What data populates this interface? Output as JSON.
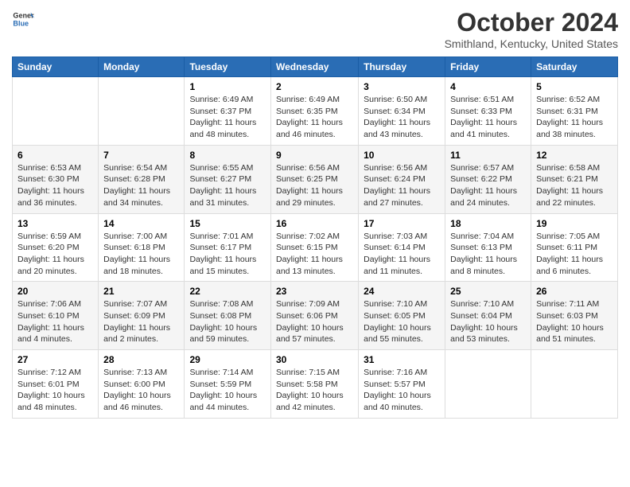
{
  "header": {
    "logo_general": "General",
    "logo_blue": "Blue",
    "title": "October 2024",
    "location": "Smithland, Kentucky, United States"
  },
  "columns": [
    "Sunday",
    "Monday",
    "Tuesday",
    "Wednesday",
    "Thursday",
    "Friday",
    "Saturday"
  ],
  "weeks": [
    [
      {
        "day": "",
        "info": ""
      },
      {
        "day": "",
        "info": ""
      },
      {
        "day": "1",
        "info": "Sunrise: 6:49 AM\nSunset: 6:37 PM\nDaylight: 11 hours and 48 minutes."
      },
      {
        "day": "2",
        "info": "Sunrise: 6:49 AM\nSunset: 6:35 PM\nDaylight: 11 hours and 46 minutes."
      },
      {
        "day": "3",
        "info": "Sunrise: 6:50 AM\nSunset: 6:34 PM\nDaylight: 11 hours and 43 minutes."
      },
      {
        "day": "4",
        "info": "Sunrise: 6:51 AM\nSunset: 6:33 PM\nDaylight: 11 hours and 41 minutes."
      },
      {
        "day": "5",
        "info": "Sunrise: 6:52 AM\nSunset: 6:31 PM\nDaylight: 11 hours and 38 minutes."
      }
    ],
    [
      {
        "day": "6",
        "info": "Sunrise: 6:53 AM\nSunset: 6:30 PM\nDaylight: 11 hours and 36 minutes."
      },
      {
        "day": "7",
        "info": "Sunrise: 6:54 AM\nSunset: 6:28 PM\nDaylight: 11 hours and 34 minutes."
      },
      {
        "day": "8",
        "info": "Sunrise: 6:55 AM\nSunset: 6:27 PM\nDaylight: 11 hours and 31 minutes."
      },
      {
        "day": "9",
        "info": "Sunrise: 6:56 AM\nSunset: 6:25 PM\nDaylight: 11 hours and 29 minutes."
      },
      {
        "day": "10",
        "info": "Sunrise: 6:56 AM\nSunset: 6:24 PM\nDaylight: 11 hours and 27 minutes."
      },
      {
        "day": "11",
        "info": "Sunrise: 6:57 AM\nSunset: 6:22 PM\nDaylight: 11 hours and 24 minutes."
      },
      {
        "day": "12",
        "info": "Sunrise: 6:58 AM\nSunset: 6:21 PM\nDaylight: 11 hours and 22 minutes."
      }
    ],
    [
      {
        "day": "13",
        "info": "Sunrise: 6:59 AM\nSunset: 6:20 PM\nDaylight: 11 hours and 20 minutes."
      },
      {
        "day": "14",
        "info": "Sunrise: 7:00 AM\nSunset: 6:18 PM\nDaylight: 11 hours and 18 minutes."
      },
      {
        "day": "15",
        "info": "Sunrise: 7:01 AM\nSunset: 6:17 PM\nDaylight: 11 hours and 15 minutes."
      },
      {
        "day": "16",
        "info": "Sunrise: 7:02 AM\nSunset: 6:15 PM\nDaylight: 11 hours and 13 minutes."
      },
      {
        "day": "17",
        "info": "Sunrise: 7:03 AM\nSunset: 6:14 PM\nDaylight: 11 hours and 11 minutes."
      },
      {
        "day": "18",
        "info": "Sunrise: 7:04 AM\nSunset: 6:13 PM\nDaylight: 11 hours and 8 minutes."
      },
      {
        "day": "19",
        "info": "Sunrise: 7:05 AM\nSunset: 6:11 PM\nDaylight: 11 hours and 6 minutes."
      }
    ],
    [
      {
        "day": "20",
        "info": "Sunrise: 7:06 AM\nSunset: 6:10 PM\nDaylight: 11 hours and 4 minutes."
      },
      {
        "day": "21",
        "info": "Sunrise: 7:07 AM\nSunset: 6:09 PM\nDaylight: 11 hours and 2 minutes."
      },
      {
        "day": "22",
        "info": "Sunrise: 7:08 AM\nSunset: 6:08 PM\nDaylight: 10 hours and 59 minutes."
      },
      {
        "day": "23",
        "info": "Sunrise: 7:09 AM\nSunset: 6:06 PM\nDaylight: 10 hours and 57 minutes."
      },
      {
        "day": "24",
        "info": "Sunrise: 7:10 AM\nSunset: 6:05 PM\nDaylight: 10 hours and 55 minutes."
      },
      {
        "day": "25",
        "info": "Sunrise: 7:10 AM\nSunset: 6:04 PM\nDaylight: 10 hours and 53 minutes."
      },
      {
        "day": "26",
        "info": "Sunrise: 7:11 AM\nSunset: 6:03 PM\nDaylight: 10 hours and 51 minutes."
      }
    ],
    [
      {
        "day": "27",
        "info": "Sunrise: 7:12 AM\nSunset: 6:01 PM\nDaylight: 10 hours and 48 minutes."
      },
      {
        "day": "28",
        "info": "Sunrise: 7:13 AM\nSunset: 6:00 PM\nDaylight: 10 hours and 46 minutes."
      },
      {
        "day": "29",
        "info": "Sunrise: 7:14 AM\nSunset: 5:59 PM\nDaylight: 10 hours and 44 minutes."
      },
      {
        "day": "30",
        "info": "Sunrise: 7:15 AM\nSunset: 5:58 PM\nDaylight: 10 hours and 42 minutes."
      },
      {
        "day": "31",
        "info": "Sunrise: 7:16 AM\nSunset: 5:57 PM\nDaylight: 10 hours and 40 minutes."
      },
      {
        "day": "",
        "info": ""
      },
      {
        "day": "",
        "info": ""
      }
    ]
  ]
}
